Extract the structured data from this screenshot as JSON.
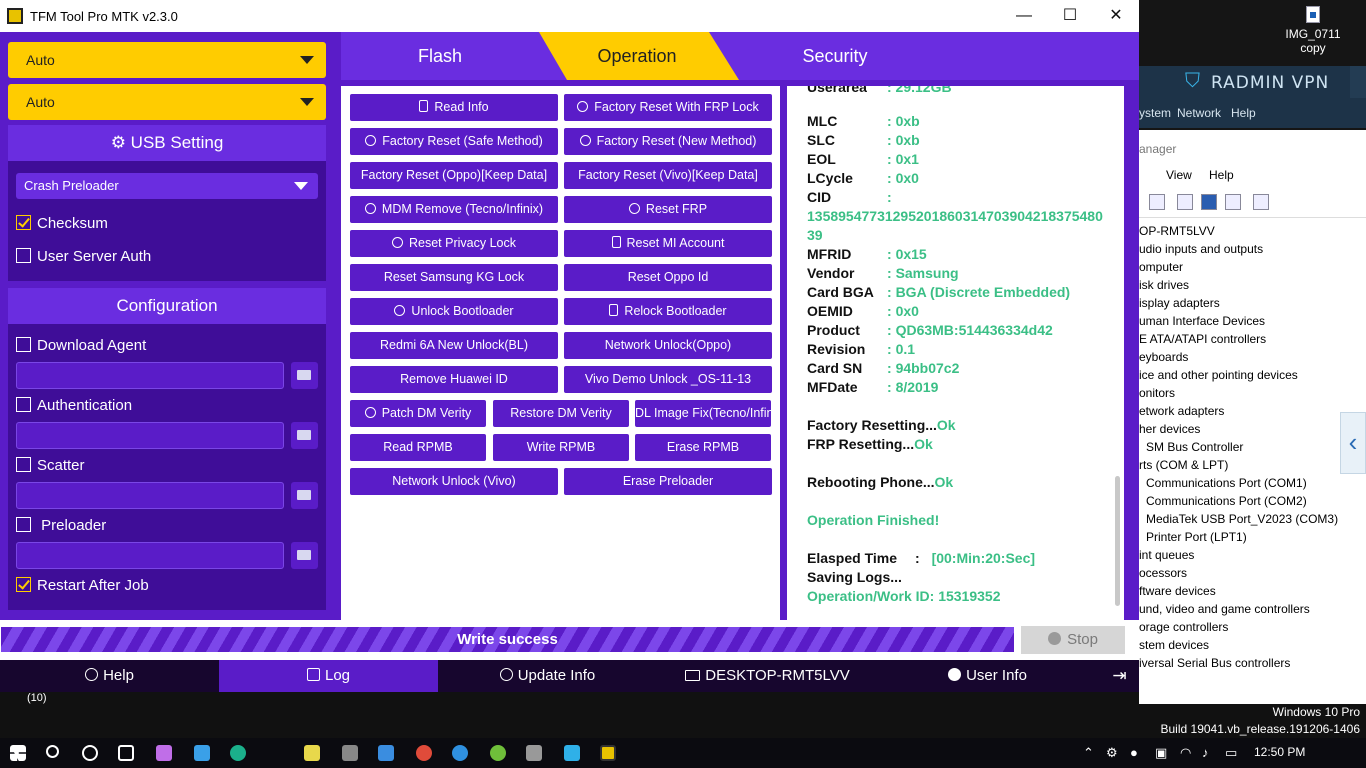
{
  "window": {
    "title": "TFM Tool Pro MTK v2.3.0"
  },
  "left": {
    "port_select": "Auto",
    "mode_select": "Auto",
    "usb_setting_title": "USB Setting",
    "usb_mode_select": "Crash Preloader",
    "checksum": {
      "label": "Checksum",
      "checked": true
    },
    "user_server_auth": {
      "label": "User Server Auth",
      "checked": false
    },
    "config_title": "Configuration",
    "download_agent": {
      "label": "Download Agent",
      "checked": false
    },
    "authentication": {
      "label": "Authentication",
      "checked": false
    },
    "scatter": {
      "label": "Scatter",
      "checked": false
    },
    "preloader": {
      "label": "Preloader",
      "checked": false
    },
    "restart_after_job": {
      "label": "Restart After Job",
      "checked": true
    }
  },
  "tabs": {
    "flash": "Flash",
    "operation": "Operation",
    "security": "Security",
    "active": "Operation"
  },
  "operations": [
    "Read Info",
    "Factory Reset With FRP Lock",
    "Factory Reset (Safe Method)",
    "Factory Reset (New Method)",
    "Factory Reset (Oppo)[Keep Data]",
    "Factory Reset (Vivo)[Keep Data]",
    "MDM Remove (Tecno/Infinix)",
    "Reset FRP",
    "Reset Privacy Lock",
    "Reset MI Account",
    "Reset Samsung KG Lock",
    "Reset Oppo Id",
    "Unlock Bootloader",
    "Relock Bootloader",
    "Redmi 6A New Unlock(BL)",
    "Network Unlock(Oppo)",
    "Remove Huawei ID",
    "Vivo Demo Unlock _OS-11-13",
    "Patch DM Verity",
    "Restore DM Verity",
    "DL Image Fix(Tecno/Infinix)",
    "Read RPMB",
    "Write RPMB",
    "Erase RPMB",
    "Network Unlock (Vivo)",
    "Erase Preloader"
  ],
  "log": {
    "partial_top": "Userarea : 29.12GB",
    "fields": [
      {
        "k": "MLC",
        "v": "0xb"
      },
      {
        "k": "SLC",
        "v": "0xb"
      },
      {
        "k": "EOL",
        "v": "0x1"
      },
      {
        "k": "LCycle",
        "v": "0x0"
      },
      {
        "k": "CID",
        "v": ""
      }
    ],
    "cid_value_1": "1358954773129520186031470390421837548​0",
    "cid_value_2": "39",
    "fields2": [
      {
        "k": "MFRID",
        "v": "0x15"
      },
      {
        "k": "Vendor",
        "v": "Samsung"
      },
      {
        "k": "Card BGA",
        "v": "BGA (Discrete Embedded)"
      },
      {
        "k": "OEMID",
        "v": "0x0"
      },
      {
        "k": "Product",
        "v": "QD63MB:514436334d42"
      },
      {
        "k": "Revision",
        "v": "0.1"
      },
      {
        "k": "Card SN",
        "v": "94bb07c2"
      },
      {
        "k": "MFDate",
        "v": "8/2019"
      }
    ],
    "factory_resetting": "Factory Resetting...",
    "frp_resetting": "FRP Resetting...",
    "rebooting": "Rebooting Phone...",
    "ok": "Ok",
    "finished": "Operation Finished!",
    "elapsed_label": "Elasped Time",
    "elapsed_value": "[00:Min:20:Sec]",
    "saving_logs": "Saving Logs...",
    "work_id": "Operation/Work ID: 15319352"
  },
  "progress": {
    "text": "Write success",
    "fraction": 1.0
  },
  "stop_label": "Stop",
  "bottom_nav": {
    "help": "Help",
    "log": "Log",
    "update_info": "Update Info",
    "pc_name": "DESKTOP-RMT5LVV",
    "user_info": "User Info",
    "active": "Log"
  },
  "desktop_icon": {
    "line1": "IMG_0711",
    "line2": "copy"
  },
  "radmin": {
    "title": "RADMIN VPN",
    "menu": [
      "ystem",
      "Network",
      "Help"
    ]
  },
  "devmgr": {
    "title": "anager",
    "menu": [
      "View",
      "Help"
    ],
    "items": [
      "OP-RMT5LVV",
      "udio inputs and outputs",
      "omputer",
      "isk drives",
      "isplay adapters",
      "uman Interface Devices",
      "E ATA/ATAPI controllers",
      "eyboards",
      "ice and other pointing devices",
      "onitors",
      "etwork adapters",
      "her devices",
      "SM Bus Controller",
      "rts (COM & LPT)",
      "Communications Port (COM1)",
      "Communications Port (COM2)",
      "MediaTek USB Port_V2023 (COM3)",
      "Printer Port (LPT1)",
      "int queues",
      "ocessors",
      "ftware devices",
      "und, video and game controllers",
      "orage controllers",
      "stem devices",
      "iversal Serial Bus controllers"
    ]
  },
  "windows_version": {
    "line1": "Windows 10 Pro",
    "line2": "Build 19041.vb_release.191206-1406"
  },
  "badge_count": "(10)",
  "taskbar": {
    "time": "12:50 PM"
  }
}
